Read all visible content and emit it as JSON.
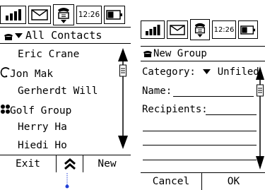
{
  "left": {
    "status": {
      "time": "12:26"
    },
    "title": {
      "label": "All Contacts"
    },
    "contacts": [
      {
        "name": "Eric Crane",
        "icon": ""
      },
      {
        "name": "Jon Mak",
        "icon": "call-icon"
      },
      {
        "name": "Gerherdt Will",
        "icon": ""
      },
      {
        "name": "Golf Group",
        "icon": "group-icon"
      },
      {
        "name": "Herry Ha",
        "icon": ""
      },
      {
        "name": "Hiedi Ho",
        "icon": ""
      }
    ],
    "softkeys": {
      "left": "Exit",
      "right": "New"
    }
  },
  "right": {
    "status": {
      "time": "12:26"
    },
    "title": {
      "label": "New Group"
    },
    "form": {
      "category_label": "Category:",
      "category_value": "Unfiled",
      "name_label": "Name:",
      "recipients_label": "Recipients:"
    },
    "softkeys": {
      "left": "Cancel",
      "right": "OK"
    }
  }
}
